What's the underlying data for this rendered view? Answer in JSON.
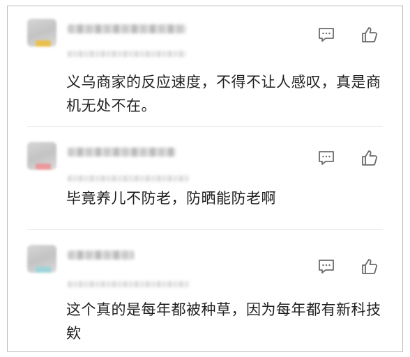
{
  "comments": [
    {
      "author": "",
      "meta": "",
      "text": "义乌商家的反应速度，不得不让人感叹，真是商机无处不在。",
      "actions": {
        "reply_icon": "comment-icon",
        "like_icon": "thumbs-up-icon"
      }
    },
    {
      "author": "",
      "meta": "",
      "text": "毕竟养儿不防老，防晒能防老啊",
      "actions": {
        "reply_icon": "comment-icon",
        "like_icon": "thumbs-up-icon"
      }
    },
    {
      "author": "",
      "meta": "",
      "text": "这个真的是每年都被种草，因为每年都有新科技欸",
      "actions": {
        "reply_icon": "comment-icon",
        "like_icon": "thumbs-up-icon"
      }
    }
  ],
  "colors": {
    "icon": "#6b6b6b",
    "text": "#1f1f1f",
    "border": "#bdbdbd",
    "divider": "#e8e8e8"
  }
}
